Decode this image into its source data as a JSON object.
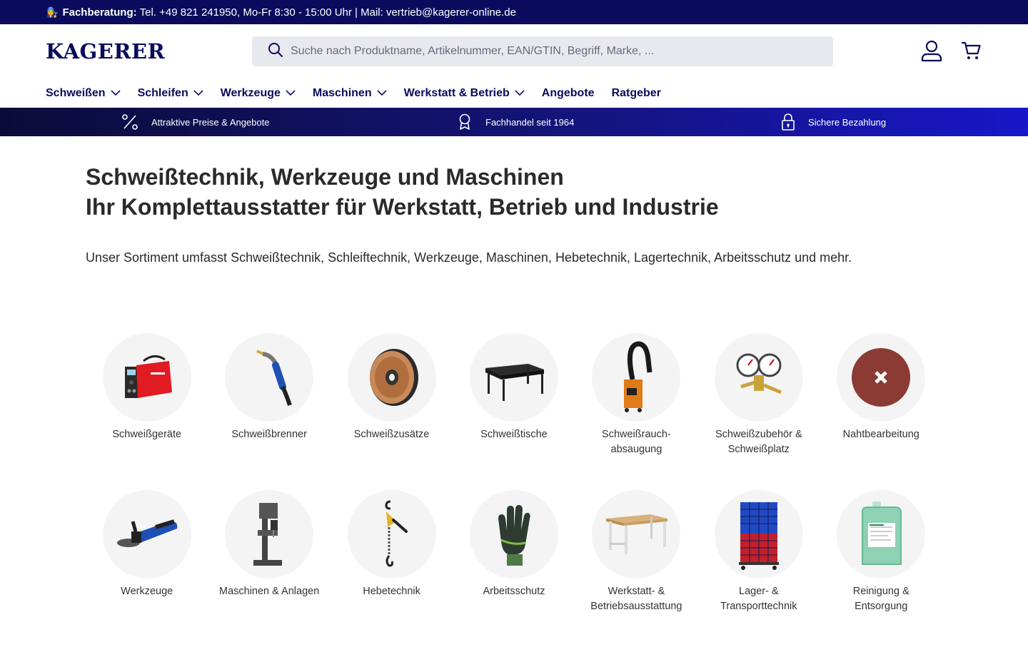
{
  "topbar": {
    "emoji": "👩‍🔧",
    "label": "Fachberatung:",
    "text": "Tel. +49 821 241950, Mo-Fr 8:30 - 15:00 Uhr | Mail: vertrieb@kagerer-online.de"
  },
  "header": {
    "logo": "KAGERER",
    "search_placeholder": "Suche nach Produktname, Artikelnummer, EAN/GTIN, Begriff, Marke, ...",
    "icons": [
      "user-icon",
      "cart-icon"
    ]
  },
  "nav": {
    "items": [
      {
        "label": "Schweißen",
        "dropdown": true
      },
      {
        "label": "Schleifen",
        "dropdown": true
      },
      {
        "label": "Werkzeuge",
        "dropdown": true
      },
      {
        "label": "Maschinen",
        "dropdown": true
      },
      {
        "label": "Werkstatt & Betrieb",
        "dropdown": true
      },
      {
        "label": "Angebote",
        "dropdown": false
      },
      {
        "label": "Ratgeber",
        "dropdown": false
      }
    ]
  },
  "benefits": [
    {
      "icon": "percent-icon",
      "label": "Attraktive Preise & Angebote"
    },
    {
      "icon": "award-icon",
      "label": "Fachhandel seit 1964"
    },
    {
      "icon": "lock-icon",
      "label": "Sichere Bezahlung"
    }
  ],
  "main": {
    "headline_1": "Schweißtechnik, Werkzeuge und Maschinen",
    "headline_2": "Ihr Komplettausstatter für Werkstatt, Betrieb und Industrie",
    "intro": "Unser Sortiment umfasst Schweißtechnik, Schleiftechnik, Werkzeuge, Maschinen, Hebetechnik, Lagertechnik, Arbeitsschutz und mehr."
  },
  "categories_row1": [
    {
      "label": "Schweißgeräte",
      "icon": "welding-machine-icon"
    },
    {
      "label": "Schweißbrenner",
      "icon": "welding-torch-icon"
    },
    {
      "label": "Schweißzusätze",
      "icon": "wire-spool-icon"
    },
    {
      "label": "Schweißtische",
      "icon": "welding-table-icon"
    },
    {
      "label": "Schweißrauch-absaugung",
      "icon": "fume-extractor-icon"
    },
    {
      "label": "Schweißzubehör & Schweißplatz",
      "icon": "pressure-regulator-icon"
    },
    {
      "label": "Nahtbearbeitung",
      "icon": "sanding-disc-icon"
    }
  ],
  "categories_row2": [
    {
      "label": "Werkzeuge",
      "icon": "angle-grinder-icon"
    },
    {
      "label": "Maschinen & Anlagen",
      "icon": "drill-press-icon"
    },
    {
      "label": "Hebetechnik",
      "icon": "lever-hoist-icon"
    },
    {
      "label": "Arbeitsschutz",
      "icon": "work-glove-icon"
    },
    {
      "label": "Werkstatt- & Betriebsausstattung",
      "icon": "workbench-icon"
    },
    {
      "label": "Lager- & Transporttechnik",
      "icon": "bin-rack-icon"
    },
    {
      "label": "Reinigung & Entsorgung",
      "icon": "canister-icon"
    }
  ],
  "colors": {
    "brand_navy": "#0a0b5c",
    "benefit_bar_end": "#1717c8",
    "search_bg": "#e8e8ef",
    "circle_bg": "#f4f4f4"
  }
}
